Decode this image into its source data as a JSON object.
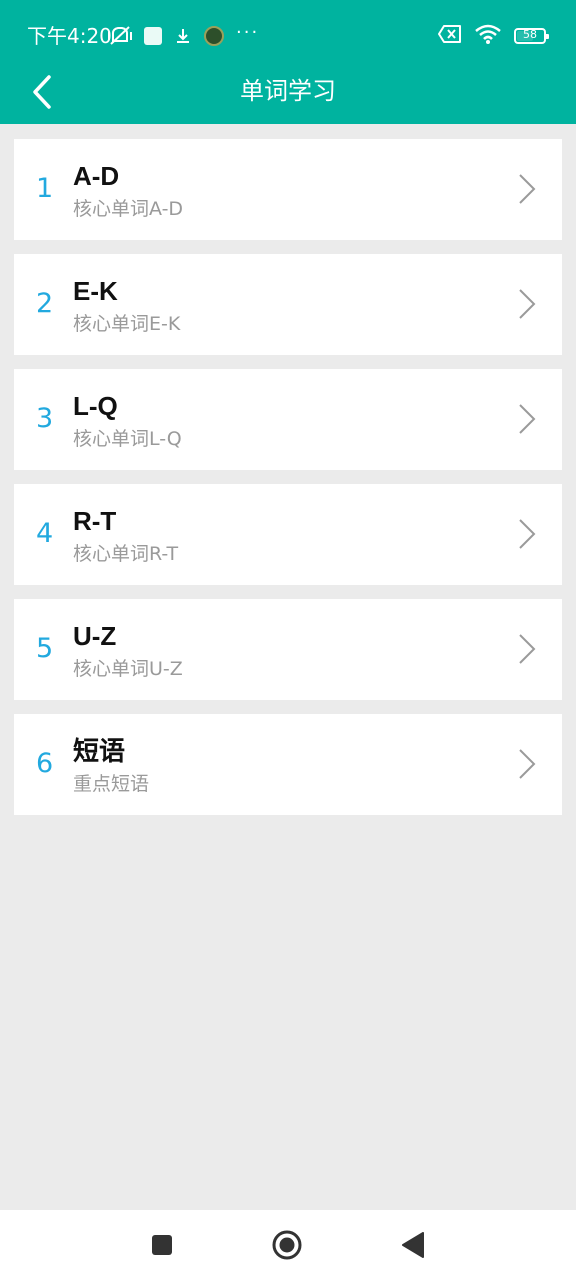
{
  "status_bar": {
    "time": "下午4:20",
    "battery": "58"
  },
  "nav": {
    "title": "单词学习"
  },
  "list": [
    {
      "index": "1",
      "title": "A-D",
      "subtitle": "核心单词A-D"
    },
    {
      "index": "2",
      "title": "E-K",
      "subtitle": "核心单词E-K"
    },
    {
      "index": "3",
      "title": "L-Q",
      "subtitle": "核心单词L-Q"
    },
    {
      "index": "4",
      "title": "R-T",
      "subtitle": "核心单词R-T"
    },
    {
      "index": "5",
      "title": "U-Z",
      "subtitle": "核心单词U-Z"
    },
    {
      "index": "6",
      "title": "短语",
      "subtitle": "重点短语"
    }
  ],
  "colors": {
    "header": "#00b39f",
    "index": "#22a9df",
    "background": "#ebebeb"
  },
  "icons": {
    "back": "chevron-left-icon",
    "item": "chevron-right-icon",
    "system_nav": [
      "square-stop-icon",
      "circle-home-icon",
      "triangle-back-icon"
    ]
  }
}
